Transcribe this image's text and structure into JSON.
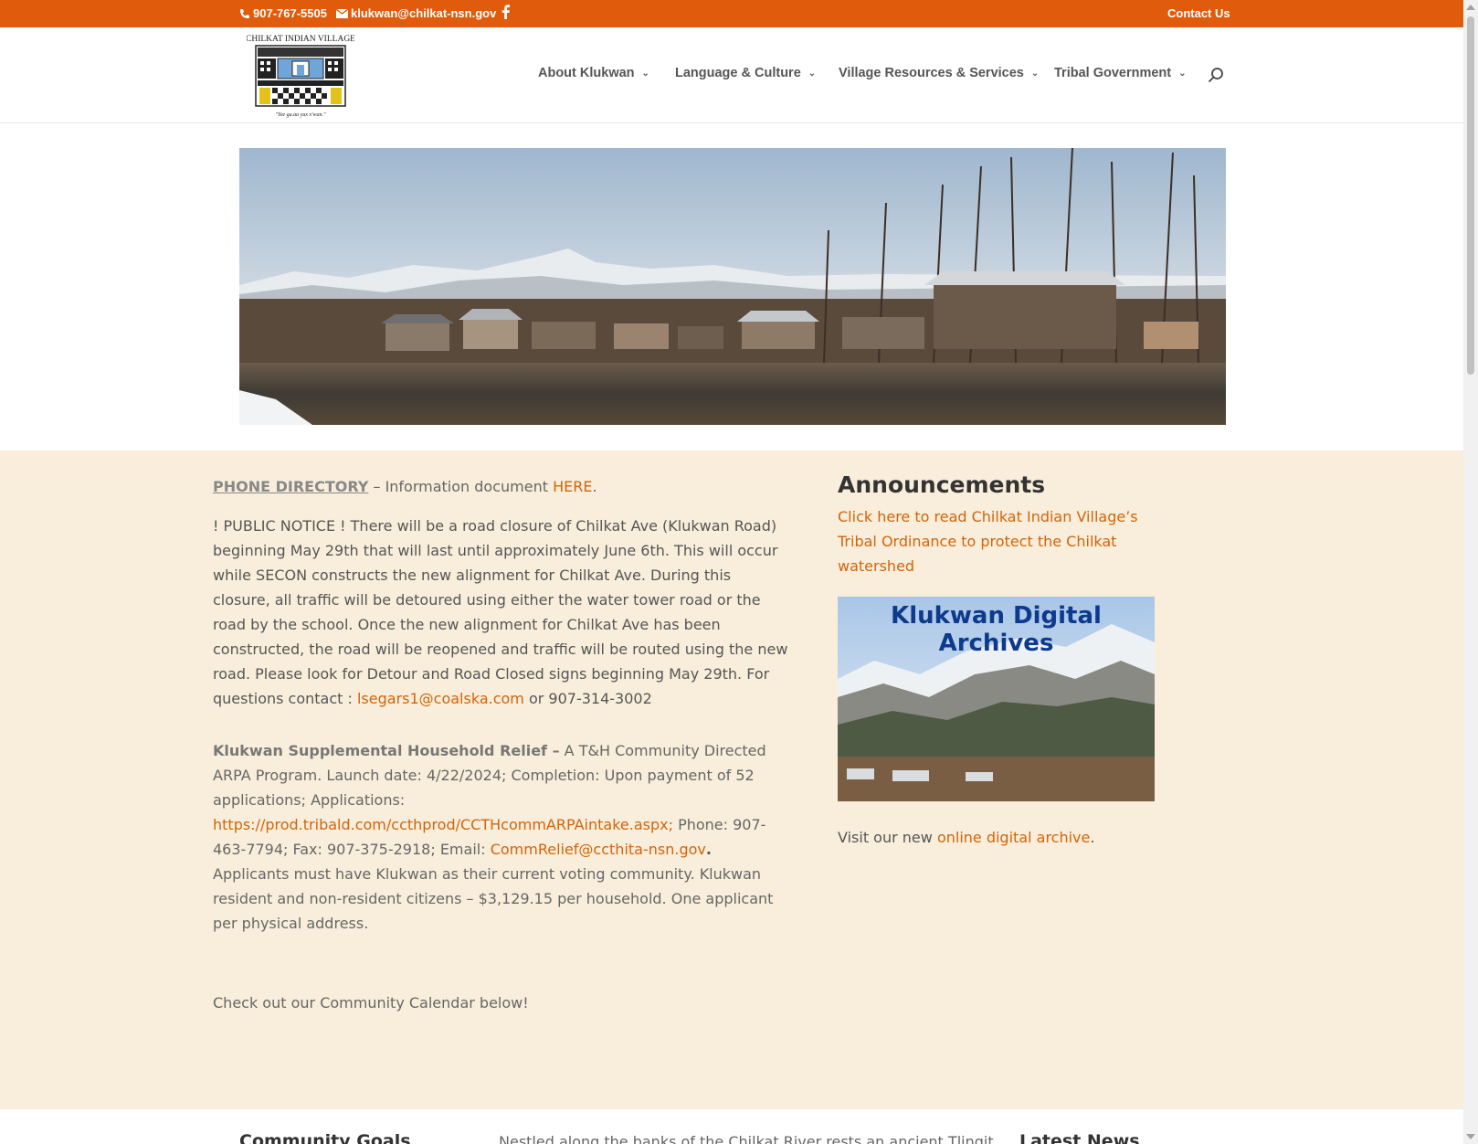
{
  "topbar": {
    "phone": "907-767-5505",
    "email": "klukwan@chilkat-nsn.gov",
    "contact": "Contact Us"
  },
  "logo": {
    "title": "CHILKAT INDIAN VILLAGE",
    "motto": "\"Yee gu.aa yax x'wan.\""
  },
  "nav": {
    "items": [
      "About Klukwan",
      "Language & Culture",
      "Village Resources & Services",
      "Tribal Government"
    ]
  },
  "main": {
    "phone_directory": "PHONE DIRECTORY",
    "phone_directory_rest": " – Information document ",
    "here": "HERE",
    "notice_text": " ! PUBLIC NOTICE ! There will be a road closure of Chilkat Ave (Klukwan Road) beginning May 29th that will last until approximately June 6th. This will occur while SECON constructs the new alignment for Chilkat Ave. During this closure, all traffic will be detoured using either the water tower road or the road by the school. Once the new alignment for Chilkat Ave has been constructed, the road will be reopened and traffic will be routed using the new road. Please look for Detour and Road Closed signs beginning May 29th. For questions contact : ",
    "notice_email": "lsegars1@coalska.com",
    "notice_tail": " or 907-314-3002",
    "relief_title": "Klukwan Supplemental Household Relief –",
    "relief_text": " A T&H Community Directed ARPA Program. Launch date: 4/22/2024; Completion: Upon payment of 52 applications; Applications: ",
    "relief_url": "https://prod.tribald.com/ccthprod/CCTHcommARPAintake.aspx;",
    "relief_contact": " Phone: 907-463-7794; Fax: 907-375-2918; Email: ",
    "relief_email": "CommRelief@ccthita-nsn.gov",
    "relief_tail": " Applicants must have Klukwan as their current voting community. Klukwan resident and non-resident citizens – $3,129.15 per household. One applicant per physical address.",
    "calendar_note": "Check out our Community Calendar below!"
  },
  "sidebar": {
    "title": "Announcements",
    "ordinance_link": "Click here to read Chilkat Indian Village’s Tribal Ordinance to protect the Chilkat watershed",
    "archive_title": "Klukwan Digital Archives",
    "visit_text": "Visit our new ",
    "visit_link": "online digital archive",
    "visit_end": "."
  },
  "bottom": {
    "goals": "Community Goals",
    "nestled": "Nestled along the banks of the Chilkat River rests an ancient Tlingit",
    "news": "Latest News"
  },
  "colors": {
    "accent": "#e05c0c",
    "link": "#d2640a",
    "cream": "#f9eedb"
  }
}
